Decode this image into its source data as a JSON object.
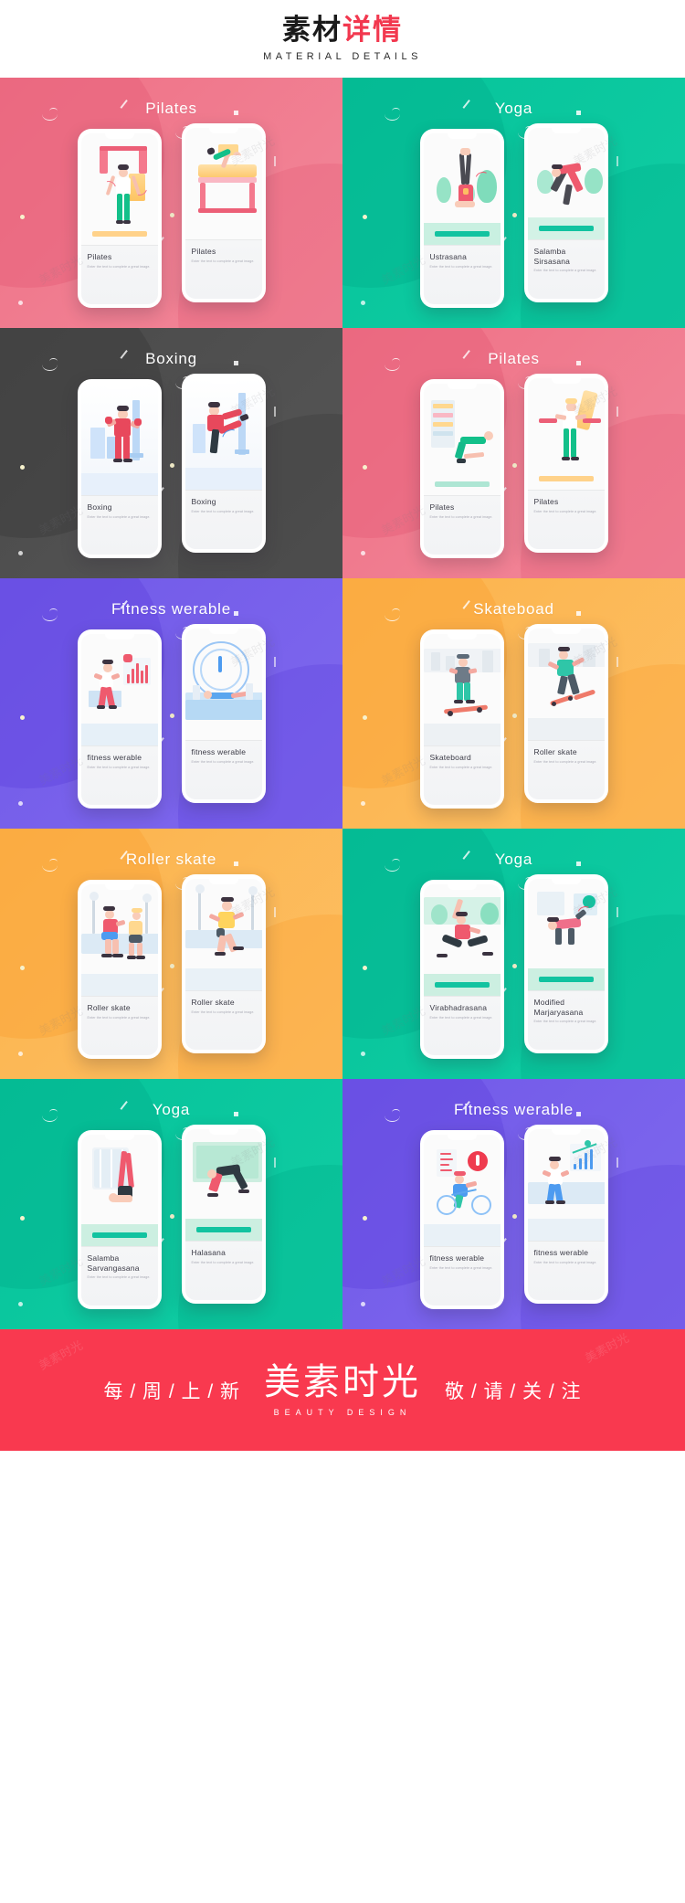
{
  "header": {
    "cn_black": "素材",
    "cn_red": "详情",
    "en": "MATERIAL DETAILS",
    "red_hex": "#f2384f"
  },
  "caption_subtext": "Enter the text to complete a great image.",
  "tiles": [
    {
      "title": "Pilates",
      "bg": "#ef7186",
      "bg2": "#f2889a",
      "blob": "#e8637c",
      "scene": "pilates-band",
      "cards": [
        {
          "title": "Pilates",
          "art": "pilates-band"
        },
        {
          "title": "Pilates",
          "art": "pilates-reformer"
        }
      ]
    },
    {
      "title": "Yoga",
      "bg": "#06c39a",
      "bg2": "#11cda4",
      "blob": "#03b48f",
      "scene": "yoga-headstand",
      "cards": [
        {
          "title": "Ustrasana",
          "art": "yoga-headstand"
        },
        {
          "title": "Salamba\nSirsasana",
          "art": "yoga-forward"
        }
      ]
    },
    {
      "title": "Boxing",
      "bg": "#4a4a4a",
      "bg2": "#565656",
      "blob": "#3e3e3e",
      "scene": "boxing",
      "cards": [
        {
          "title": "Boxing",
          "art": "boxing-guard"
        },
        {
          "title": "Boxing",
          "art": "boxing-kick"
        }
      ]
    },
    {
      "title": "Pilates",
      "bg": "#ef7186",
      "bg2": "#f2889a",
      "blob": "#e8637c",
      "scene": "pilates-floor",
      "cards": [
        {
          "title": "Pilates",
          "art": "pilates-floor"
        },
        {
          "title": "Pilates",
          "art": "pilates-stand"
        }
      ]
    },
    {
      "title": "Fitness werable",
      "bg": "#7159e8",
      "bg2": "#7f69ee",
      "blob": "#6449e0",
      "scene": "fitness-run",
      "cards": [
        {
          "title": "fitness werable",
          "art": "fitness-run"
        },
        {
          "title": "fitness werable",
          "art": "fitness-swim"
        }
      ]
    },
    {
      "title": "Skateboad",
      "bg": "#fcb34c",
      "bg2": "#fdbf63",
      "blob": "#f9a53a",
      "scene": "skate",
      "cards": [
        {
          "title": "Skateboard",
          "art": "skateboard"
        },
        {
          "title": "Roller skate",
          "art": "rollerskate"
        }
      ]
    },
    {
      "title": "Roller skate",
      "bg": "#fcb34c",
      "bg2": "#fdbf63",
      "blob": "#f9a53a",
      "scene": "roller",
      "cards": [
        {
          "title": "Roller skate",
          "art": "roller-two"
        },
        {
          "title": "Roller skate",
          "art": "roller-one"
        }
      ]
    },
    {
      "title": "Yoga",
      "bg": "#06c39a",
      "bg2": "#11cda4",
      "blob": "#03b48f",
      "scene": "yoga-warrior",
      "cards": [
        {
          "title": "Virabhadrasana",
          "art": "yoga-warrior"
        },
        {
          "title": "Modified\nMarjaryasana",
          "art": "yoga-cat"
        }
      ]
    },
    {
      "title": "Yoga",
      "bg": "#06c39a",
      "bg2": "#11cda4",
      "blob": "#03b48f",
      "scene": "yoga-shoulder",
      "cards": [
        {
          "title": "Salamba\nSarvangasana",
          "art": "yoga-shoulder"
        },
        {
          "title": "Halasana",
          "art": "yoga-plow"
        }
      ]
    },
    {
      "title": "Fitness werable",
      "bg": "#7159e8",
      "bg2": "#7f69ee",
      "blob": "#6449e0",
      "scene": "fitness-bike",
      "cards": [
        {
          "title": "fitness werable",
          "art": "fitness-bike"
        },
        {
          "title": "fitness werable",
          "art": "fitness-walk"
        }
      ]
    }
  ],
  "footer": {
    "left": "每 / 周 / 上 / 新",
    "brand": "美素时光",
    "brand_sub": "BEAUTY  DESIGN",
    "right": "敬 / 请 / 关 / 注",
    "bg_hex": "#f9394f"
  },
  "watermark": "美素时光"
}
